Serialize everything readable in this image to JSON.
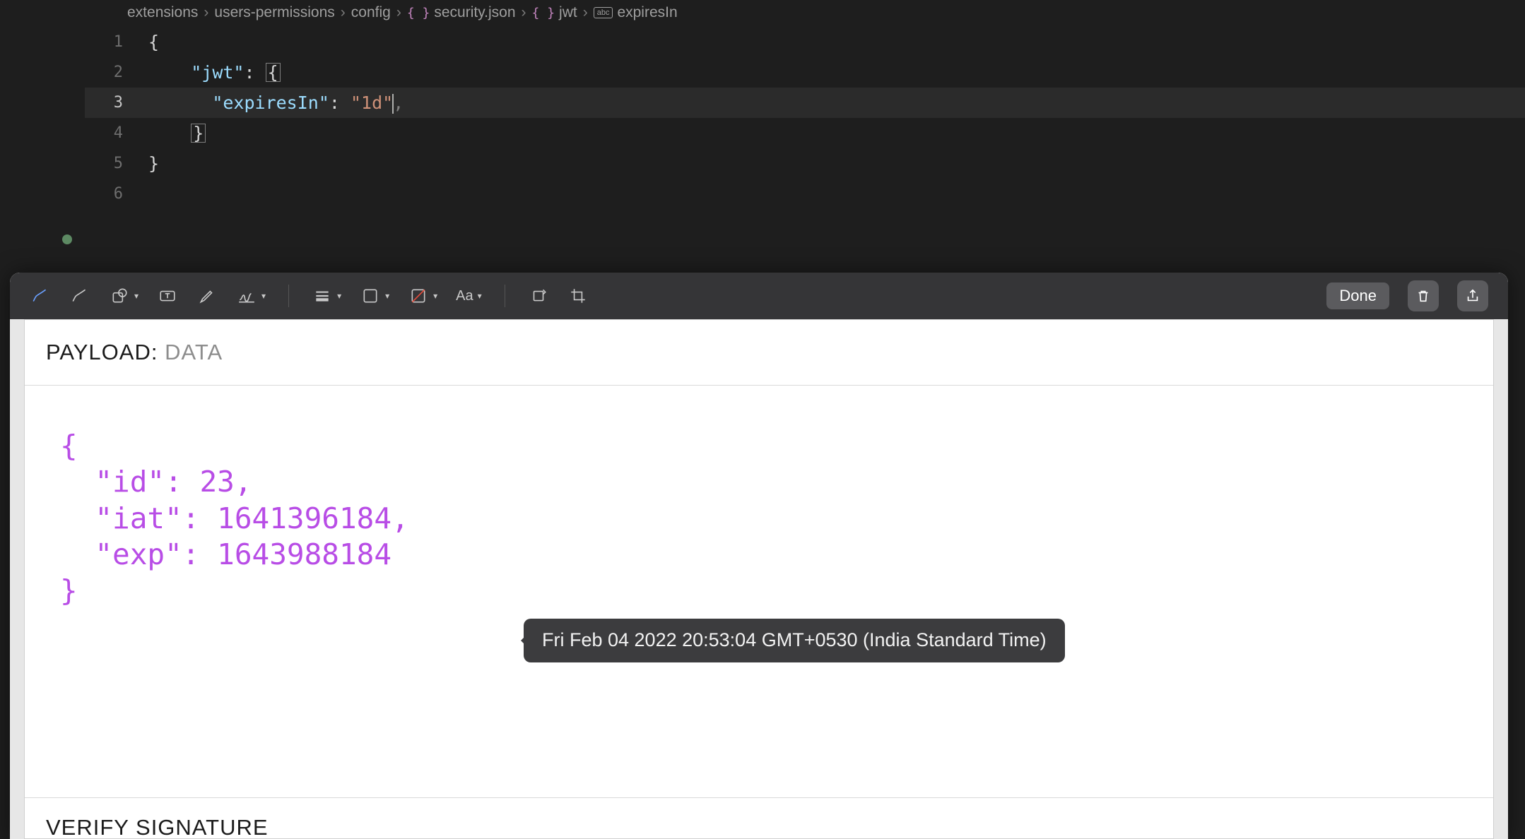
{
  "breadcrumb": {
    "seg1": "extensions",
    "seg2": "users-permissions",
    "seg3": "config",
    "seg4": "security.json",
    "seg5": "jwt",
    "seg6": "expiresIn"
  },
  "code": {
    "key_jwt": "\"jwt\"",
    "key_expiresIn": "\"expiresIn\"",
    "val_expiresIn": "\"1d\"",
    "lines": {
      "l1": "1",
      "l2": "2",
      "l3": "3",
      "l4": "4",
      "l5": "5",
      "l6": "6"
    }
  },
  "toolbar": {
    "done_label": "Done",
    "text_style_label": "Aa"
  },
  "panel": {
    "payload_label": "PAYLOAD:",
    "payload_sub": " DATA",
    "verify_label": "VERIFY SIGNATURE"
  },
  "payload": {
    "open": "{",
    "id_key": "\"id\"",
    "id_val": "23",
    "iat_key": "\"iat\"",
    "iat_val": "1641396184",
    "exp_key": "\"exp\"",
    "exp_val": "1643988184",
    "close": "}"
  },
  "tooltip": {
    "text": "Fri Feb 04 2022 20:53:04 GMT+0530 (India Standard Time)"
  }
}
